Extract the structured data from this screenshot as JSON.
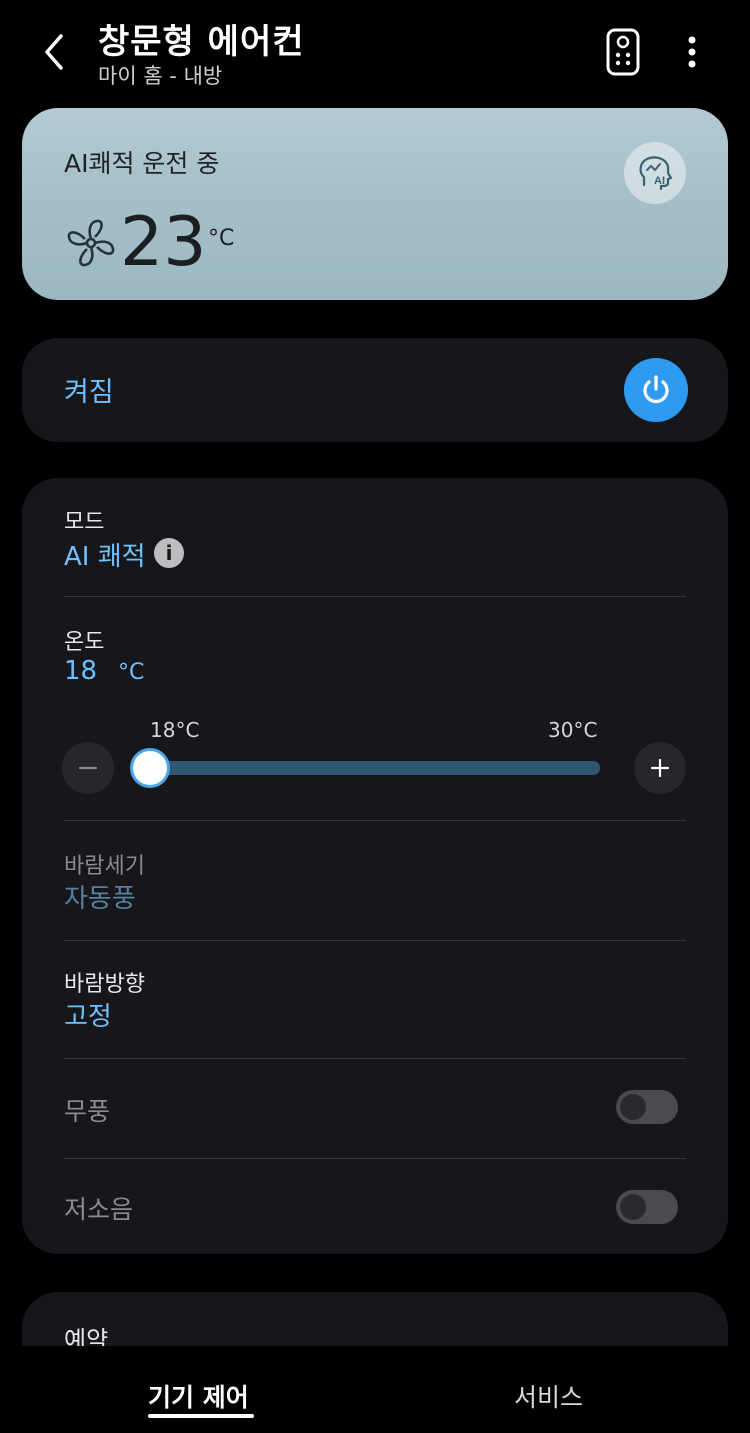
{
  "header": {
    "title": "창문형 에어컨",
    "subtitle": "마이 홈 - 내방"
  },
  "status": {
    "label": "AI쾌적 운전 중",
    "temperature": "23",
    "unit": "°C",
    "ai_badge_text": "AI"
  },
  "power": {
    "label": "켜짐",
    "is_on": true
  },
  "controls": {
    "mode": {
      "label": "모드",
      "value": "AI 쾌적",
      "info_glyph": "i"
    },
    "temperature": {
      "label": "온도",
      "value": "18",
      "unit": "°C",
      "min_label": "18°C",
      "max_label": "30°C",
      "min": 18,
      "max": 30,
      "current": 18
    },
    "fan_speed": {
      "label": "바람세기",
      "value": "자동풍"
    },
    "fan_direction": {
      "label": "바람방향",
      "value": "고정"
    },
    "windless": {
      "label": "무풍",
      "enabled": false
    },
    "quiet": {
      "label": "저소음",
      "enabled": false
    }
  },
  "schedule": {
    "label": "예약"
  },
  "bottom_nav": {
    "tabs": [
      {
        "label": "기기 제어",
        "active": true
      },
      {
        "label": "서비스",
        "active": false
      }
    ]
  },
  "colors": {
    "accent": "#6ec0ff",
    "power_button": "#2e9bf0",
    "card_background": "#17171b",
    "status_card": "#a6c0c8"
  }
}
